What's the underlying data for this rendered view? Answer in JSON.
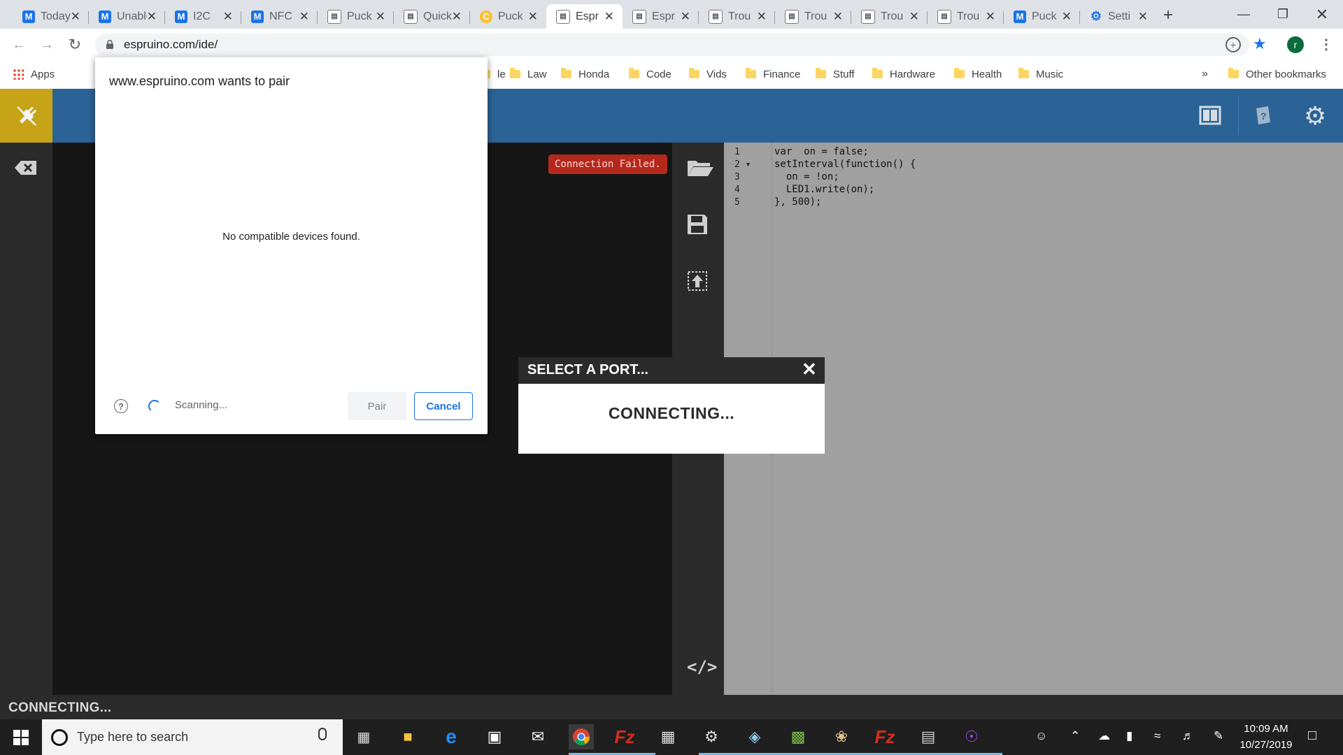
{
  "browser": {
    "tabs": [
      {
        "title": "Today",
        "favicon": "M",
        "kind": "m"
      },
      {
        "title": "Unable",
        "favicon": "M",
        "kind": "m"
      },
      {
        "title": "I2C",
        "favicon": "M",
        "kind": "m"
      },
      {
        "title": "NFC",
        "favicon": "M",
        "kind": "m"
      },
      {
        "title": "Puck",
        "favicon": "espruino-icon",
        "kind": "e"
      },
      {
        "title": "Quick",
        "favicon": "espruino-icon",
        "kind": "e"
      },
      {
        "title": "Puck",
        "favicon": "C",
        "kind": "c"
      },
      {
        "title": "Espr",
        "favicon": "espruino-icon",
        "kind": "e",
        "active": true
      },
      {
        "title": "Espr",
        "favicon": "espruino-icon",
        "kind": "e"
      },
      {
        "title": "Trou",
        "favicon": "espruino-icon",
        "kind": "e"
      },
      {
        "title": "Trou",
        "favicon": "espruino-icon",
        "kind": "e"
      },
      {
        "title": "Trou",
        "favicon": "espruino-icon",
        "kind": "e"
      },
      {
        "title": "Trou",
        "favicon": "espruino-icon",
        "kind": "e"
      },
      {
        "title": "Puck",
        "favicon": "M",
        "kind": "m"
      },
      {
        "title": "Setti",
        "favicon": "gear-icon",
        "kind": "g"
      }
    ],
    "new_tab": "+",
    "url": "espruino.com/ide/",
    "profile_initial": "r",
    "bookmarks": [
      {
        "label": "Apps",
        "icon": "apps-grid-icon"
      },
      {
        "label": "le",
        "icon": "folder-icon"
      },
      {
        "label": "Law",
        "icon": "folder-icon"
      },
      {
        "label": "Honda",
        "icon": "folder-icon"
      },
      {
        "label": "Code",
        "icon": "folder-icon"
      },
      {
        "label": "Vids",
        "icon": "folder-icon"
      },
      {
        "label": "Finance",
        "icon": "folder-icon"
      },
      {
        "label": "Stuff",
        "icon": "folder-icon"
      },
      {
        "label": "Hardware",
        "icon": "folder-icon"
      },
      {
        "label": "Health",
        "icon": "folder-icon"
      },
      {
        "label": "Music",
        "icon": "folder-icon"
      }
    ],
    "bookmarks_overflow": "»",
    "other_bookmarks": "Other bookmarks"
  },
  "pair_dialog": {
    "title": "www.espruino.com wants to pair",
    "empty_message": "No compatible devices found.",
    "scanning": "Scanning...",
    "pair_label": "Pair",
    "cancel_label": "Cancel",
    "help": "?"
  },
  "ide": {
    "connection_failed": "Connection Failed.",
    "status": "CONNECTING...",
    "code_lines": [
      {
        "n": "1",
        "text": "var  on = false;"
      },
      {
        "n": "2 ▾",
        "text": "setInterval(function() {"
      },
      {
        "n": "3",
        "text": "  on = !on;"
      },
      {
        "n": "4",
        "text": "  LED1.write(on);"
      },
      {
        "n": "5",
        "text": "}, 500);"
      }
    ],
    "port_dialog": {
      "title": "SELECT A PORT...",
      "message": "CONNECTING...",
      "close": "✕"
    }
  },
  "taskbar": {
    "search_placeholder": "Type here to search",
    "time": "10:09 AM",
    "date": "10/27/2019"
  },
  "colors": {
    "ide_toolbar": "#2b6396",
    "connect_button": "#c7a317",
    "connection_failed": "#b5291d",
    "chrome_accent": "#1a73e8"
  }
}
